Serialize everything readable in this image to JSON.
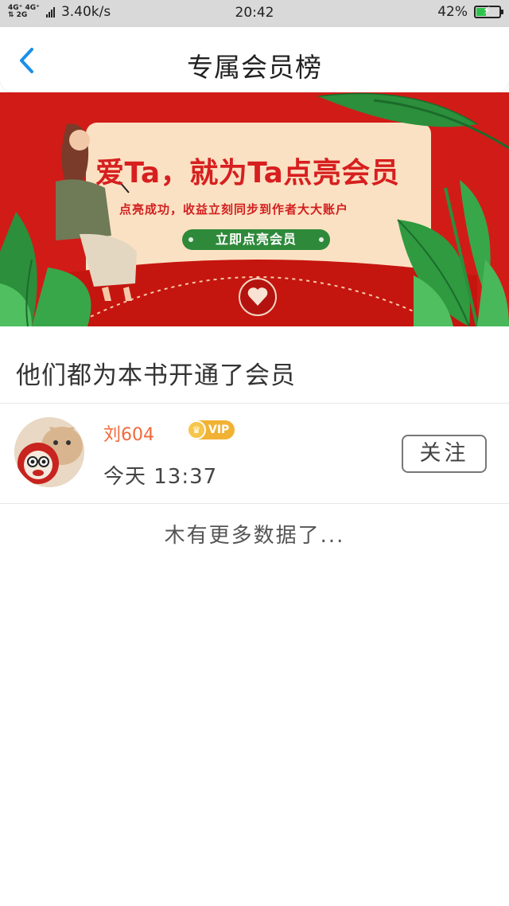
{
  "status_bar": {
    "network_top": "4G⁺ 4G⁺",
    "network_bottom": "⇅ 2G",
    "speed": "3.40k/s",
    "time": "20:42",
    "battery_percent": "42%",
    "battery_level": 0.42,
    "battery_color": "#2fc24a"
  },
  "header": {
    "title": "专属会员榜",
    "back_icon": "chevron-left-icon",
    "accent": "#1a8fe8"
  },
  "banner": {
    "headline": "爱Ta，就为Ta点亮会员",
    "subtitle": "点亮成功，收益立刻同步到作者大大账户",
    "cta": "立即点亮会员",
    "background": "#d11b17"
  },
  "section": {
    "heading": "他们都为本书开通了会员"
  },
  "members": [
    {
      "name": "刘604",
      "badge": "VIP",
      "time": "今天 13:37",
      "follow_label": "关注"
    }
  ],
  "footer": {
    "no_more": "木有更多数据了..."
  }
}
